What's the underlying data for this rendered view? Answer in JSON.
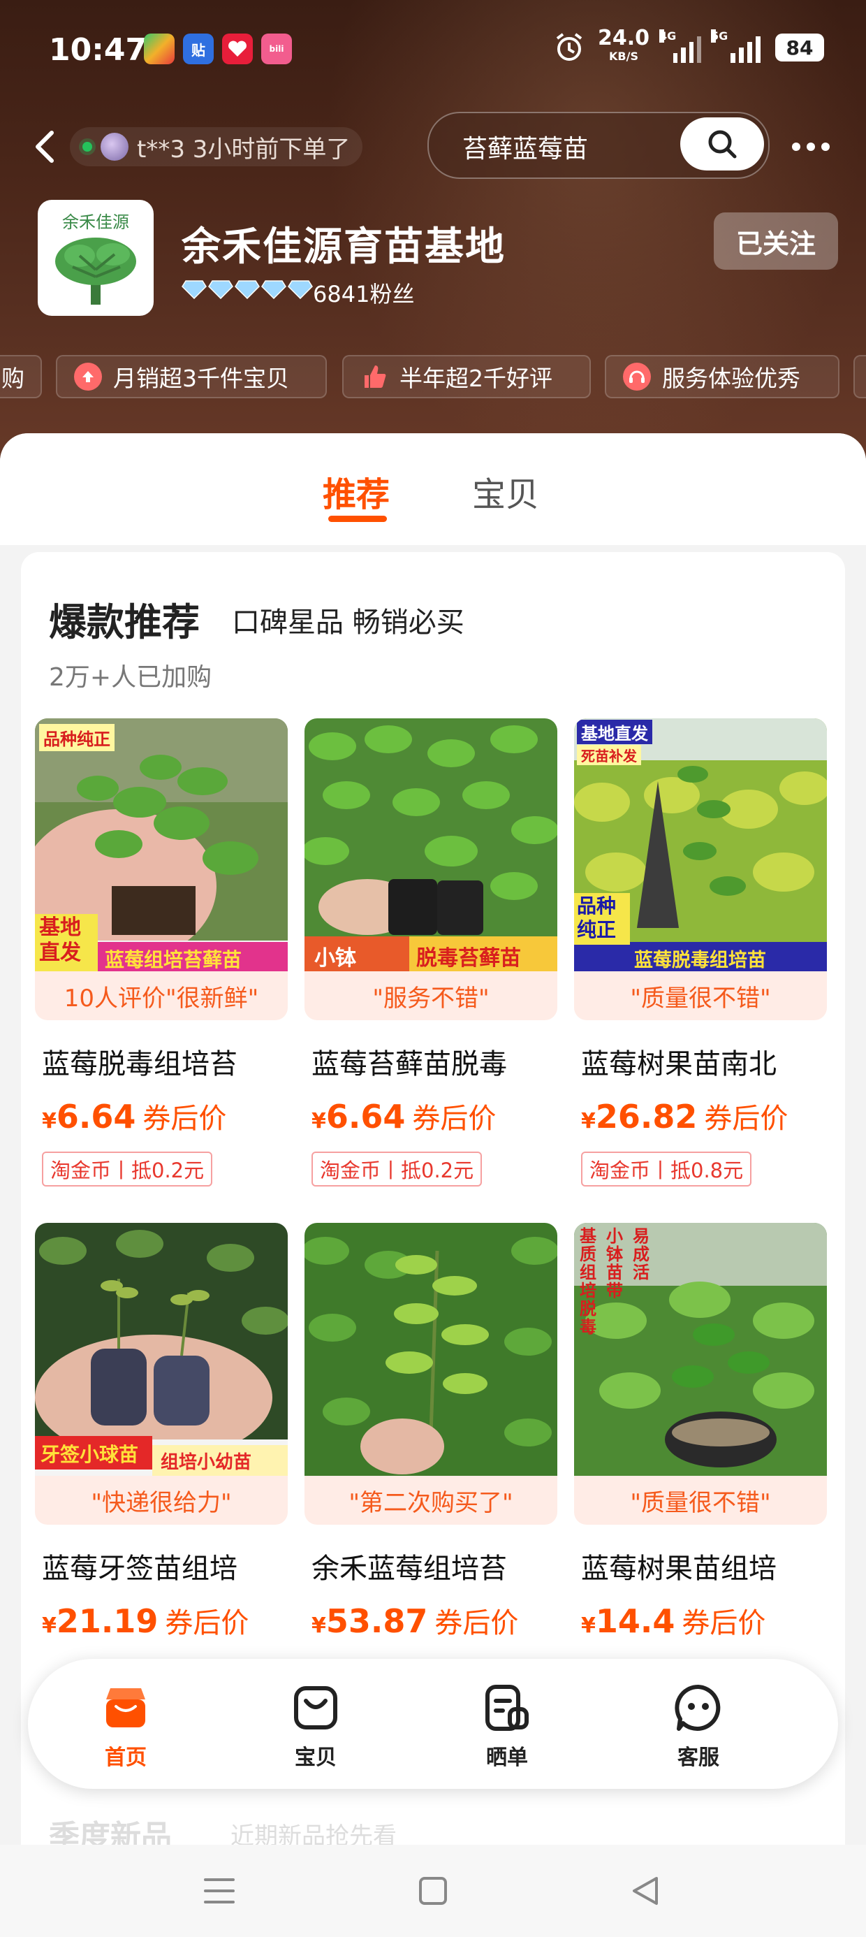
{
  "status_bar": {
    "time": "10:47",
    "apps": [
      "app-icon-1",
      "贴",
      "app-icon-3",
      "bilibili"
    ],
    "net_speed": "24.0",
    "net_unit": "KB/S",
    "signal1": "4G",
    "signal2": "5G",
    "battery": "84"
  },
  "nav": {
    "order_notice": "t**3 3小时前下单了",
    "search_text": "苔藓蓝莓苗"
  },
  "shop": {
    "logo_text": "余禾佳源",
    "name": "余禾佳源育苗基地",
    "fans": "6841粉丝",
    "follow_label": "已关注"
  },
  "badges": [
    {
      "label": "购"
    },
    {
      "label": "月销超3千件宝贝"
    },
    {
      "label": "半年超2千好评"
    },
    {
      "label": "服务体验优秀"
    }
  ],
  "tabs": [
    {
      "label": "推荐",
      "active": true
    },
    {
      "label": "宝贝",
      "active": false
    }
  ],
  "section": {
    "title": "爆款推荐",
    "subtitle": "口碑星品 畅销必买",
    "meta": "2万+人已加购"
  },
  "products": [
    {
      "tag": "10人评价\"很新鲜\"",
      "title": "蓝莓脱毒组培苔",
      "currency": "¥",
      "price": "6.64",
      "price_label": "券后价",
      "coin": "淘金币丨抵0.2元",
      "img_top": "品种纯正",
      "img_side": "基地直发",
      "img_bottom": "蓝莓组培苔藓苗"
    },
    {
      "tag": "\"服务不错\"",
      "title": "蓝莓苔藓苗脱毒",
      "currency": "¥",
      "price": "6.64",
      "price_label": "券后价",
      "coin": "淘金币丨抵0.2元",
      "img_left": "小钵",
      "img_right": "脱毒苔藓苗"
    },
    {
      "tag": "\"质量很不错\"",
      "title": "蓝莓树果苗南北",
      "currency": "¥",
      "price": "26.82",
      "price_label": "券后价",
      "coin": "淘金币丨抵0.8元",
      "img_top1": "基地直发",
      "img_top2": "死苗补发",
      "img_side": "品种纯正",
      "img_bottom": "蓝莓脱毒组培苗"
    },
    {
      "tag": "\"快递很给力\"",
      "title": "蓝莓牙签苗组培",
      "currency": "¥",
      "price": "21.19",
      "price_label": "券后价",
      "img_left": "牙签小球苗",
      "img_right": "组培小幼苗"
    },
    {
      "tag": "\"第二次购买了\"",
      "title": "余禾蓝莓组培苔",
      "currency": "¥",
      "price": "53.87",
      "price_label": "券后价"
    },
    {
      "tag": "\"质量很不错\"",
      "title": "蓝莓树果苗组培",
      "currency": "¥",
      "price": "14.4",
      "price_label": "券后价",
      "img_col1": "基质组培脱毒",
      "img_col2": "小钵苗带",
      "img_col3": "易成活"
    }
  ],
  "bottom_nav": [
    {
      "label": "首页",
      "active": true
    },
    {
      "label": "宝贝",
      "active": false
    },
    {
      "label": "晒单",
      "active": false
    },
    {
      "label": "客服",
      "active": false
    }
  ],
  "peek": {
    "title": "季度新品",
    "subtitle": "近期新品抢先看"
  },
  "colors": {
    "accent": "#ff5000",
    "header_bg": "#4a2619",
    "tag_bg": "#ffece6"
  }
}
